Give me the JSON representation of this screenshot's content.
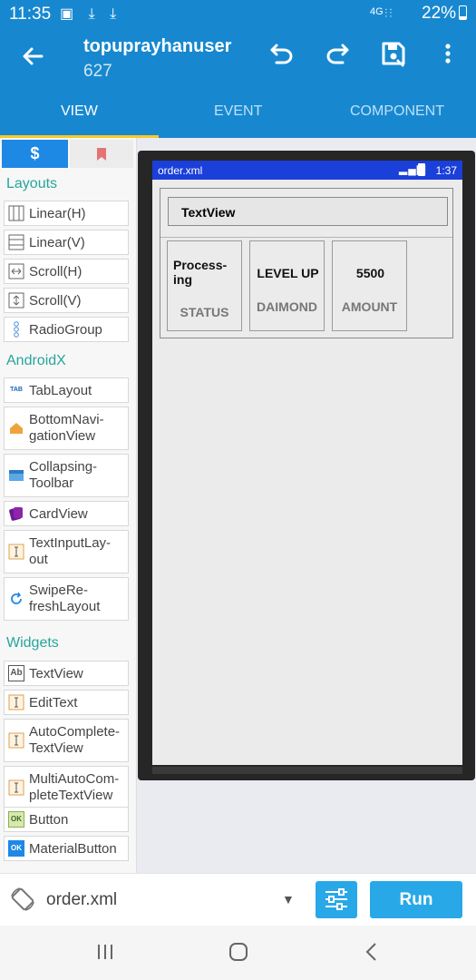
{
  "status_bar": {
    "time": "11:35",
    "notif_icons": "▣ ⤓ ⤓",
    "network": "4G",
    "signal": "⫶⫶",
    "battery": "22%"
  },
  "app_bar": {
    "title": "topuprayhanuser",
    "subtitle": "627",
    "icons": [
      "back-arrow-icon",
      "undo-icon",
      "redo-icon",
      "save-icon",
      "more-vert-icon"
    ]
  },
  "tabs": [
    "VIEW",
    "EVENT",
    "COMPONENT"
  ],
  "palette": {
    "tab_icon_1": "$",
    "sections": [
      {
        "title": "Layouts",
        "items": [
          "Linear(H)",
          "Linear(V)",
          "Scroll(H)",
          "Scroll(V)",
          "RadioGroup"
        ]
      },
      {
        "title": "AndroidX",
        "items": [
          "TabLayout",
          "BottomNavi-\ngationView",
          "Collapsing-\nToolbar",
          "CardView",
          "TextInputLay-\nout",
          "SwipeRe-\nfreshLayout"
        ]
      },
      {
        "title": "Widgets",
        "items": [
          "TextView",
          "EditText",
          "AutoComplete-\nTextView",
          "MultiAutoCom-\npleteTextView",
          "Button",
          "MaterialButton"
        ]
      }
    ]
  },
  "preview": {
    "filename": "order.xml",
    "time": "1:37",
    "signal": "▂▄▆",
    "textview": "TextView",
    "cells": [
      {
        "value": "Process-\ning",
        "label": "STATUS"
      },
      {
        "value": "LEVEL UP",
        "label": "DAIMOND"
      },
      {
        "value": "5500",
        "label": "AMOUNT"
      }
    ]
  },
  "bottom_bar": {
    "filename": "order.xml",
    "dropdown": "▼",
    "run": "Run"
  },
  "nav": [
    "recents-icon",
    "home-icon",
    "back-icon"
  ],
  "colors": {
    "primary": "#1788d0",
    "accent": "#f6c928",
    "teal": "#26a69a",
    "run": "#29a8e8"
  }
}
